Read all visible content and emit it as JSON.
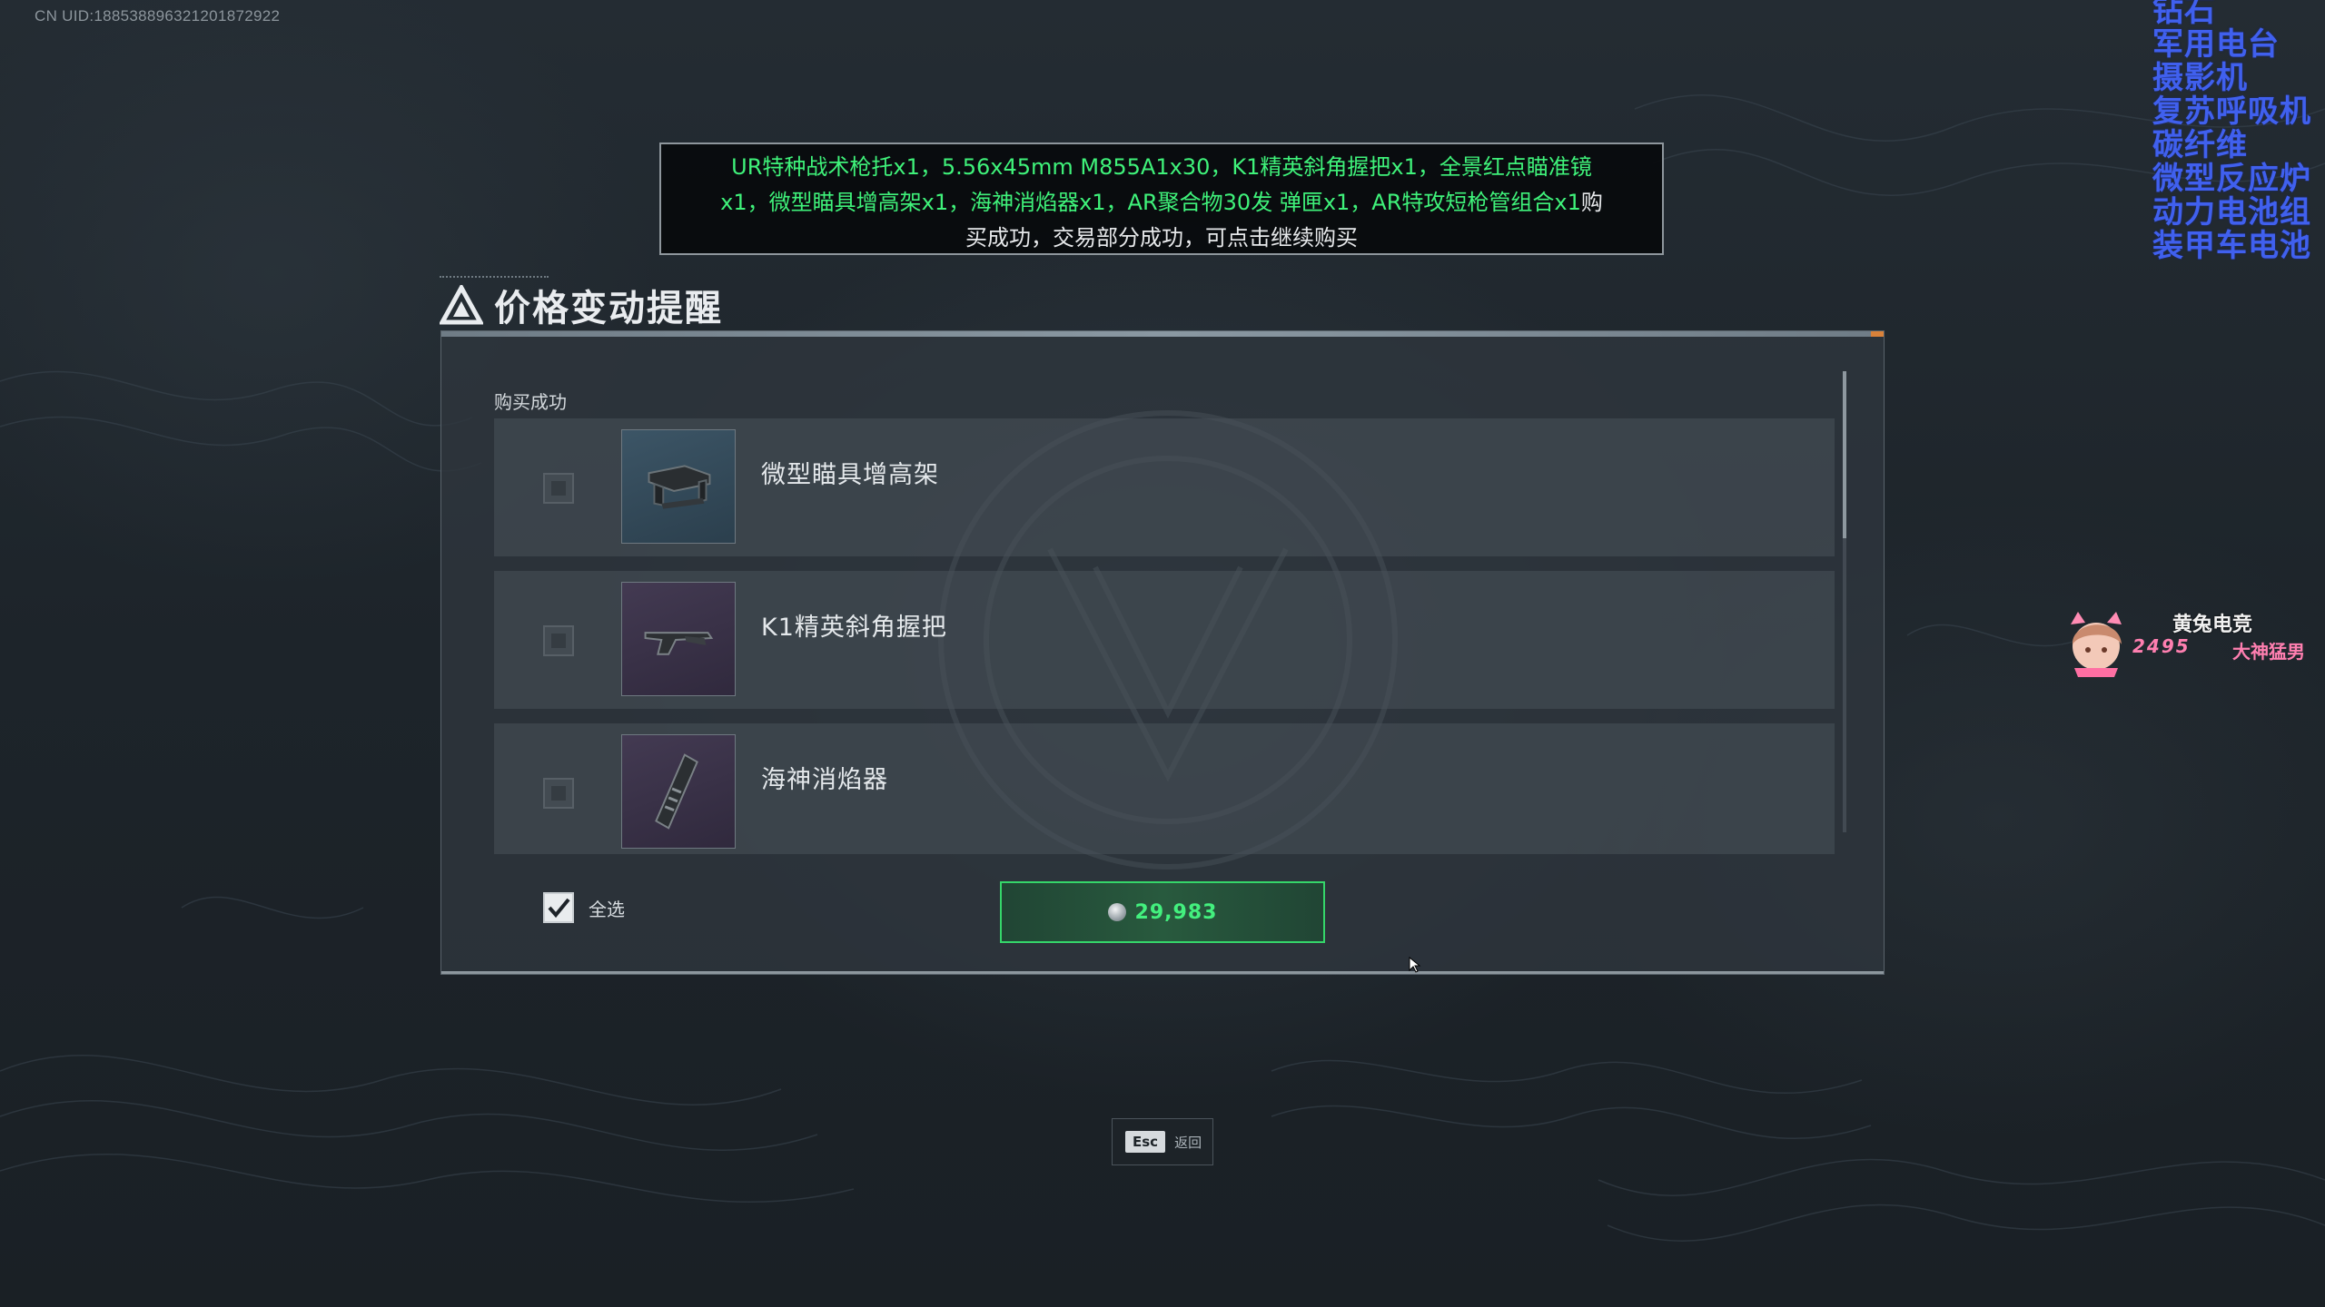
{
  "uid_text": "CN UID:188538896321201872922",
  "toast": {
    "line1": "UR特种战术枪托x1，5.56x45mm M855A1x30，K1精英斜角握把x1，全景红点瞄准镜",
    "line2_green": "x1，微型瞄具增高架x1，海神消焰器x1，AR聚合物30发 弹匣x1，AR特攻短枪管组合x1",
    "line2_white": "购",
    "line3": "买成功，交易部分成功，可点击继续购买"
  },
  "dialog": {
    "title": "价格变动提醒",
    "section_label": "购买成功",
    "items": [
      {
        "name": "微型瞄具增高架",
        "icon": "scope-riser-icon",
        "rarity_color": "#3c5566"
      },
      {
        "name": "K1精英斜角握把",
        "icon": "angled-grip-icon",
        "rarity_color": "#433a52"
      },
      {
        "name": "海神消焰器",
        "icon": "flash-hider-icon",
        "rarity_color": "#433a52"
      }
    ],
    "select_all_label": "全选",
    "select_all_checked": true,
    "price": "29,983"
  },
  "esc": {
    "key": "Esc",
    "label": "返回"
  },
  "overlay": {
    "list": [
      "钻石",
      "军用电台",
      "摄影机",
      "复苏呼吸机",
      "碳纤维",
      "微型反应炉",
      "动力电池组",
      "装甲车电池"
    ],
    "badge_title": "黄兔电竞",
    "badge_number": "2495",
    "badge_right": "大神猛男"
  },
  "colors": {
    "accent_green": "#3ff27a",
    "overlay_blue": "#4060ee",
    "panel_bg": "#2e363d"
  }
}
